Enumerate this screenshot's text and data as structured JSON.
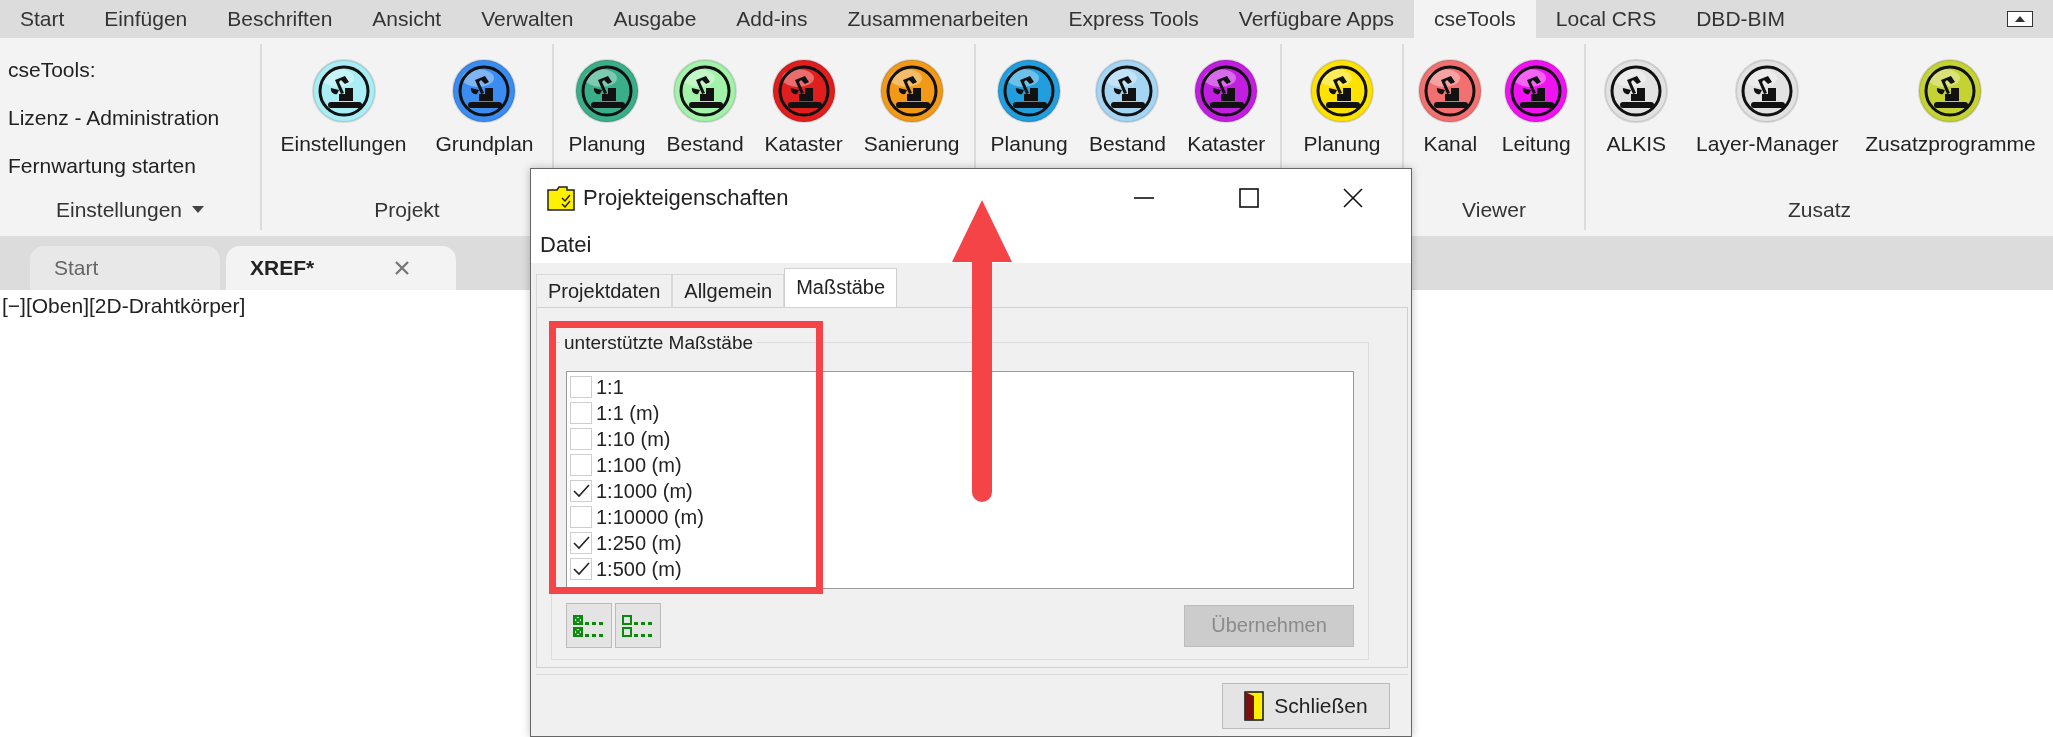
{
  "ribbon_tabs": [
    {
      "label": "Start",
      "selected": false
    },
    {
      "label": "Einfügen",
      "selected": false
    },
    {
      "label": "Beschriften",
      "selected": false
    },
    {
      "label": "Ansicht",
      "selected": false
    },
    {
      "label": "Verwalten",
      "selected": false
    },
    {
      "label": "Ausgabe",
      "selected": false
    },
    {
      "label": "Add-ins",
      "selected": false
    },
    {
      "label": "Zusammenarbeiten",
      "selected": false
    },
    {
      "label": "Express Tools",
      "selected": false
    },
    {
      "label": "Verfügbare Apps",
      "selected": false
    },
    {
      "label": "cseTools",
      "selected": true
    },
    {
      "label": "Local CRS",
      "selected": false
    },
    {
      "label": "DBD-BIM",
      "selected": false
    }
  ],
  "ribbon_groups": [
    {
      "kind": "links",
      "label": "Einstellungen",
      "dropdown": true,
      "items": [
        {
          "label": "cseTools:"
        },
        {
          "label": "Lizenz - Administration"
        },
        {
          "label": "Fernwartung starten"
        }
      ]
    },
    {
      "kind": "buttons",
      "label": "Projekt",
      "dropdown": false,
      "items": [
        {
          "label": "Einstellungen",
          "color": "#a8eef4"
        },
        {
          "label": "Grundplan",
          "color": "#3b8cf0"
        }
      ]
    },
    {
      "kind": "buttons",
      "items": [
        {
          "label": "Planung",
          "color": "#3aae88"
        },
        {
          "label": "Bestand",
          "color": "#a2f2aa"
        },
        {
          "label": "Kataster",
          "color": "#e01e1e"
        },
        {
          "label": "Sanierung",
          "color": "#f29a18"
        }
      ]
    },
    {
      "kind": "buttons",
      "items": [
        {
          "label": "Planung",
          "color": "#229ede"
        },
        {
          "label": "Bestand",
          "color": "#a4d6f4"
        },
        {
          "label": "Kataster",
          "color": "#c21ee0"
        }
      ]
    },
    {
      "kind": "buttons",
      "items": [
        {
          "label": "Planung",
          "color": "#ffe200"
        }
      ]
    },
    {
      "kind": "buttons",
      "label": "Viewer",
      "dropdown": false,
      "items": [
        {
          "label": "Kanal",
          "color": "#f27070"
        },
        {
          "label": "Leitung",
          "color": "#f012f0"
        }
      ]
    },
    {
      "kind": "buttons",
      "label": "Zusatz",
      "dropdown": false,
      "items": [
        {
          "label": "ALKIS",
          "color": "#e2e2e2"
        },
        {
          "label": "Layer-Manager",
          "color": "#e2e2e2"
        },
        {
          "label": "Zusatzprogramme",
          "color": "#c4d234"
        }
      ]
    }
  ],
  "document_tabs": [
    {
      "label": "Start",
      "selected": false
    },
    {
      "label": "XREF*",
      "selected": true,
      "closable": true
    }
  ],
  "viewport_label": "[−][Oben][2D-Drahtkörper]",
  "dialog": {
    "title": "Projekteigenschaften",
    "menu": [
      "Datei"
    ],
    "tabs": [
      {
        "label": "Projektdaten",
        "selected": false
      },
      {
        "label": "Allgemein",
        "selected": false
      },
      {
        "label": "Maßstäbe",
        "selected": true
      }
    ],
    "group_title": "unterstützte Maßstäbe",
    "scales": [
      {
        "label": "1:1",
        "checked": false
      },
      {
        "label": "1:1 (m)",
        "checked": false
      },
      {
        "label": "1:10 (m)",
        "checked": false
      },
      {
        "label": "1:100 (m)",
        "checked": false
      },
      {
        "label": "1:1000 (m)",
        "checked": true
      },
      {
        "label": "1:10000 (m)",
        "checked": false
      },
      {
        "label": "1:250 (m)",
        "checked": true
      },
      {
        "label": "1:500 (m)",
        "checked": true
      }
    ],
    "apply_button": {
      "label": "Übernehmen",
      "disabled": true
    },
    "close_button": {
      "label": "Schließen"
    }
  }
}
